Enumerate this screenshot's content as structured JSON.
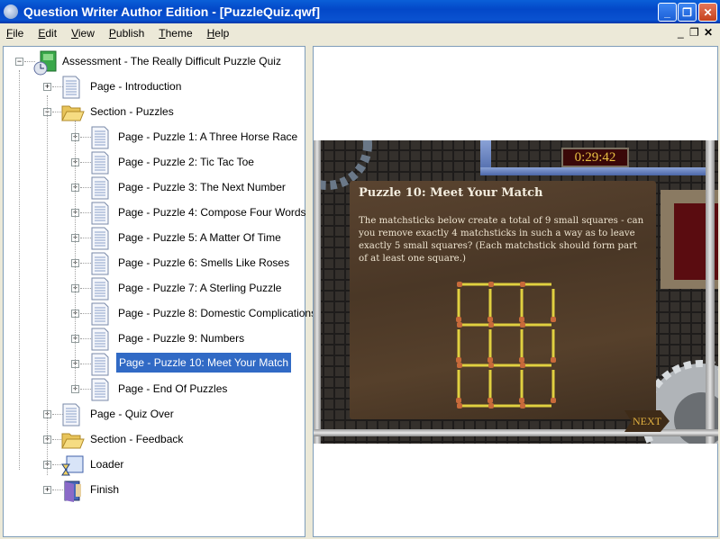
{
  "window": {
    "title": "Question Writer Author Edition - [PuzzleQuiz.qwf]"
  },
  "menu": [
    {
      "label": "File",
      "key": "F",
      "rest": "ile"
    },
    {
      "label": "Edit",
      "key": "E",
      "rest": "dit"
    },
    {
      "label": "View",
      "key": "V",
      "rest": "iew"
    },
    {
      "label": "Publish",
      "key": "P",
      "rest": "ublish"
    },
    {
      "label": "Theme",
      "key": "T",
      "rest": "heme"
    },
    {
      "label": "Help",
      "key": "H",
      "rest": "elp"
    }
  ],
  "tree": [
    {
      "label": "Assessment - The Really Difficult Puzzle Quiz",
      "level": 0,
      "icon": "assessment-icon",
      "expanded": true
    },
    {
      "label": "Page - Introduction",
      "level": 1,
      "icon": "page-icon",
      "expanded": false
    },
    {
      "label": "Section - Puzzles",
      "level": 1,
      "icon": "folder-open-icon",
      "expanded": true
    },
    {
      "label": "Page - Puzzle 1: A Three Horse Race",
      "level": 2,
      "icon": "page-icon"
    },
    {
      "label": "Page - Puzzle 2: Tic Tac Toe",
      "level": 2,
      "icon": "page-icon"
    },
    {
      "label": "Page - Puzzle 3: The Next Number",
      "level": 2,
      "icon": "page-icon"
    },
    {
      "label": "Page - Puzzle 4: Compose Four Words",
      "level": 2,
      "icon": "page-icon"
    },
    {
      "label": "Page - Puzzle 5: A Matter Of Time",
      "level": 2,
      "icon": "page-icon"
    },
    {
      "label": "Page - Puzzle 6: Smells Like Roses",
      "level": 2,
      "icon": "page-icon"
    },
    {
      "label": "Page - Puzzle 7: A Sterling Puzzle",
      "level": 2,
      "icon": "page-icon"
    },
    {
      "label": "Page - Puzzle 8: Domestic Complications",
      "level": 2,
      "icon": "page-icon"
    },
    {
      "label": "Page - Puzzle 9: Numbers",
      "level": 2,
      "icon": "page-icon"
    },
    {
      "label": "Page - Puzzle 10: Meet Your Match",
      "level": 2,
      "icon": "page-icon",
      "selected": true
    },
    {
      "label": "Page - End Of Puzzles",
      "level": 2,
      "icon": "page-icon"
    },
    {
      "label": "Page - Quiz Over",
      "level": 1,
      "icon": "page-icon"
    },
    {
      "label": "Section - Feedback",
      "level": 1,
      "icon": "folder-icon"
    },
    {
      "label": "Loader",
      "level": 1,
      "icon": "loader-icon"
    },
    {
      "label": "Finish",
      "level": 1,
      "icon": "finish-icon"
    }
  ],
  "preview": {
    "timer": "0:29:42",
    "title": "Puzzle 10: Meet Your Match",
    "text": "The matchsticks below create a total of 9 small squares - can you remove exactly 4 matchsticks in such a way as to leave exactly 5 small squares? (Each matchstick should form part of at least one square.)",
    "next_label": "NEXT",
    "grid": {
      "rows": 3,
      "cols": 3
    }
  },
  "colors": {
    "selection": "#316ac5",
    "titlebar": "#0a52d0",
    "match": "#e0d040",
    "match_head": "#c86a3a"
  }
}
